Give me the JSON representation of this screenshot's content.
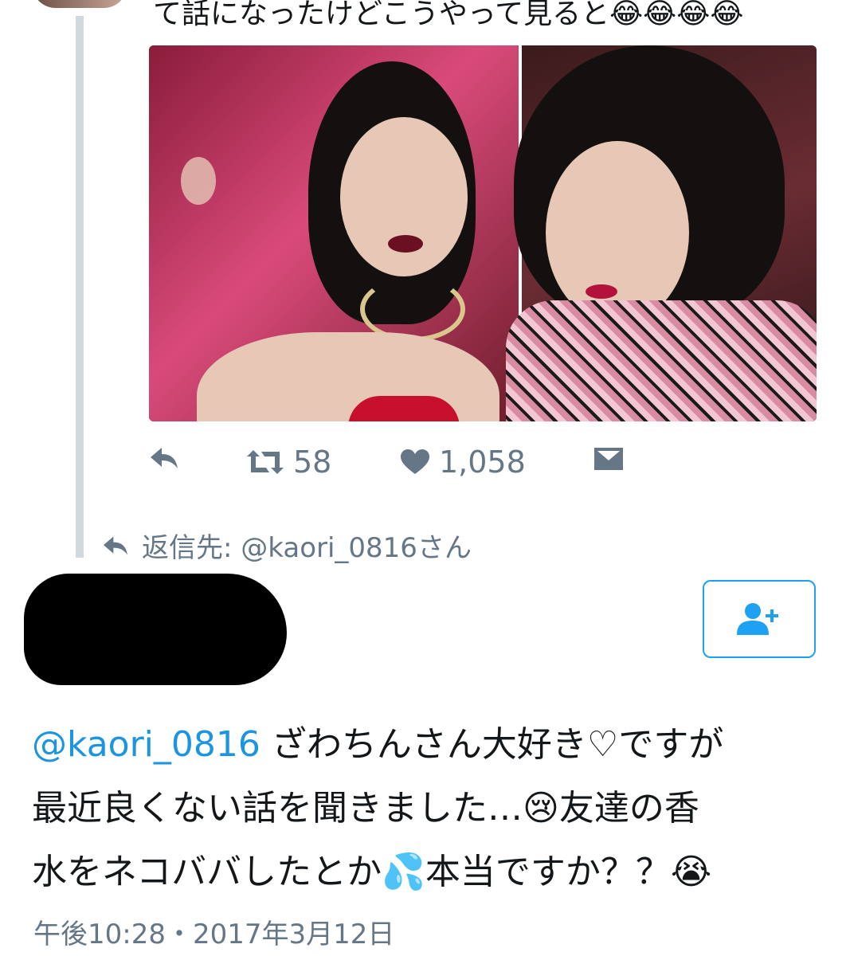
{
  "prev_tweet": {
    "text_tail": "て話になったけどこうやって見ると😂😂😂😂"
  },
  "prev_actions": {
    "retweet_count": "58",
    "like_count": "1,058"
  },
  "reply_context": {
    "label": "返信先: @kaori_0816さん"
  },
  "tweet": {
    "mention": "@kaori_0816",
    "line1_rest": " ざわちんさん大好き♡ですが",
    "line2": "最近良くない話を聞きました…",
    "line2_emoji": "😢",
    "line2_rest": "友達の香",
    "line3": "水をネコババしたとか",
    "line3_emoji": "💦",
    "line3_rest": "本当ですか？？",
    "line3_emoji2": "😭",
    "timestamp": "午後10:28・2017年3月12日"
  },
  "colors": {
    "accent": "#1da1f2",
    "mention": "#1b95e0",
    "muted": "#657786",
    "thread_line": "#cfd9de"
  }
}
